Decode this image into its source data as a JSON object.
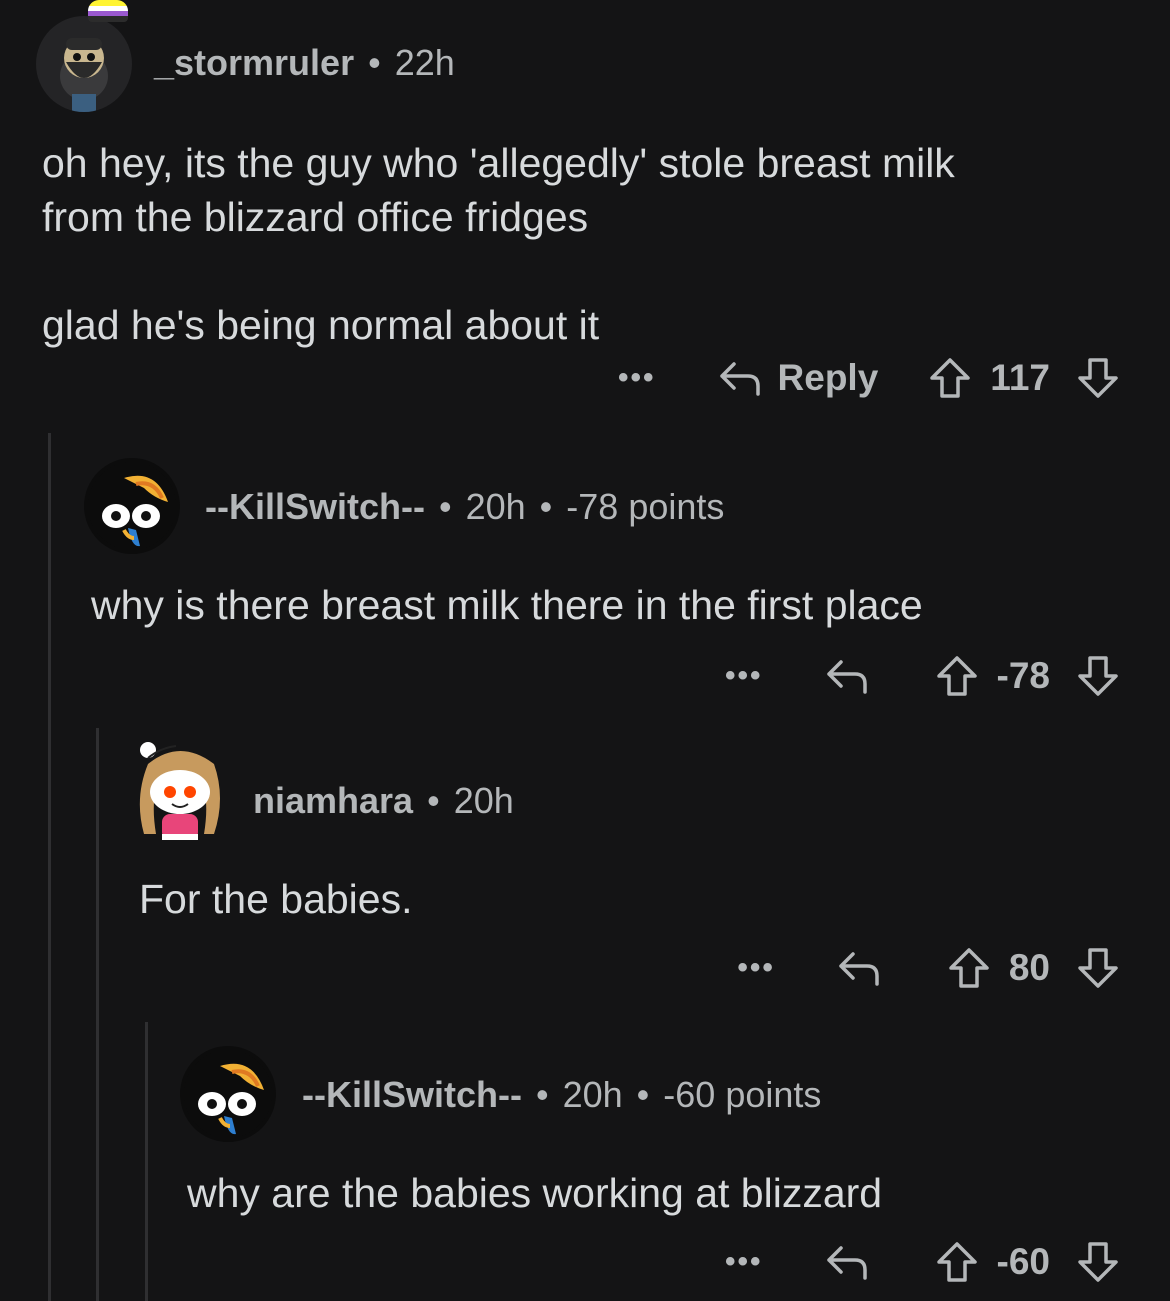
{
  "comments": [
    {
      "username": "_stormruler",
      "time": "22h",
      "points": "",
      "body": "oh hey, its the guy who 'allegedly' stole breast milk\nfrom the blizzard office fridges\n\nglad he's being normal about it",
      "reply_label": "Reply",
      "score": "117",
      "more": "•••"
    },
    {
      "username": "--KillSwitch--",
      "time": "20h",
      "points": "-78 points",
      "body": "why is there breast milk there in the first place",
      "reply_label": "",
      "score": "-78",
      "more": "•••"
    },
    {
      "username": "niamhara",
      "time": "20h",
      "points": "",
      "body": "For the babies.",
      "reply_label": "",
      "score": "80",
      "more": "•••"
    },
    {
      "username": "--KillSwitch--",
      "time": "20h",
      "points": "-60 points",
      "body": "why are the babies working at blizzard",
      "reply_label": "",
      "score": "-60",
      "more": "•••"
    }
  ],
  "separator": "•",
  "colors": {
    "background": "#141415",
    "text": "#d7dadc",
    "meta": "#b4b7b9",
    "thread_line": "#2f2f31"
  },
  "icons": [
    "reply-arrow-icon",
    "upvote-icon",
    "downvote-icon",
    "more-options-icon",
    "nonbinary-flag-badge-icon"
  ]
}
